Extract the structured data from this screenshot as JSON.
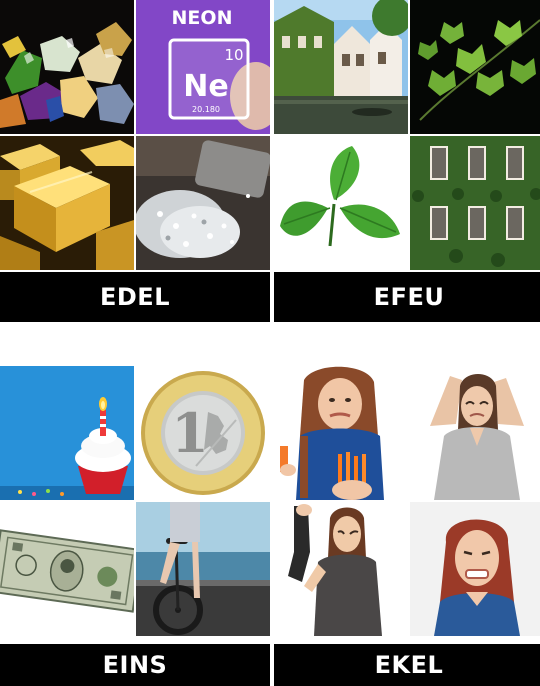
{
  "puzzles": [
    {
      "word": "EDEL",
      "images": [
        "gemstones-image",
        "neon-element-image",
        "gold-bars-image",
        "diamonds-image"
      ],
      "neon_card": {
        "title": "NEON",
        "symbol": "Ne",
        "number": "10",
        "mass": "20.180"
      }
    },
    {
      "word": "EFEU",
      "images": [
        "ivy-houses-canal-image",
        "ivy-leaves-image",
        "ivy-leaf-image",
        "ivy-covered-wall-image"
      ]
    },
    {
      "word": "EINS",
      "images": [
        "birthday-cupcake-image",
        "euro-coin-image",
        "dollar-bill-image",
        "unicycle-image"
      ],
      "euro_coin": {
        "numeral": "1"
      }
    },
    {
      "word": "EKEL",
      "images": [
        "disgusted-girl-image",
        "armpit-smell-image",
        "smelly-sock-image",
        "grimacing-woman-image"
      ]
    }
  ]
}
